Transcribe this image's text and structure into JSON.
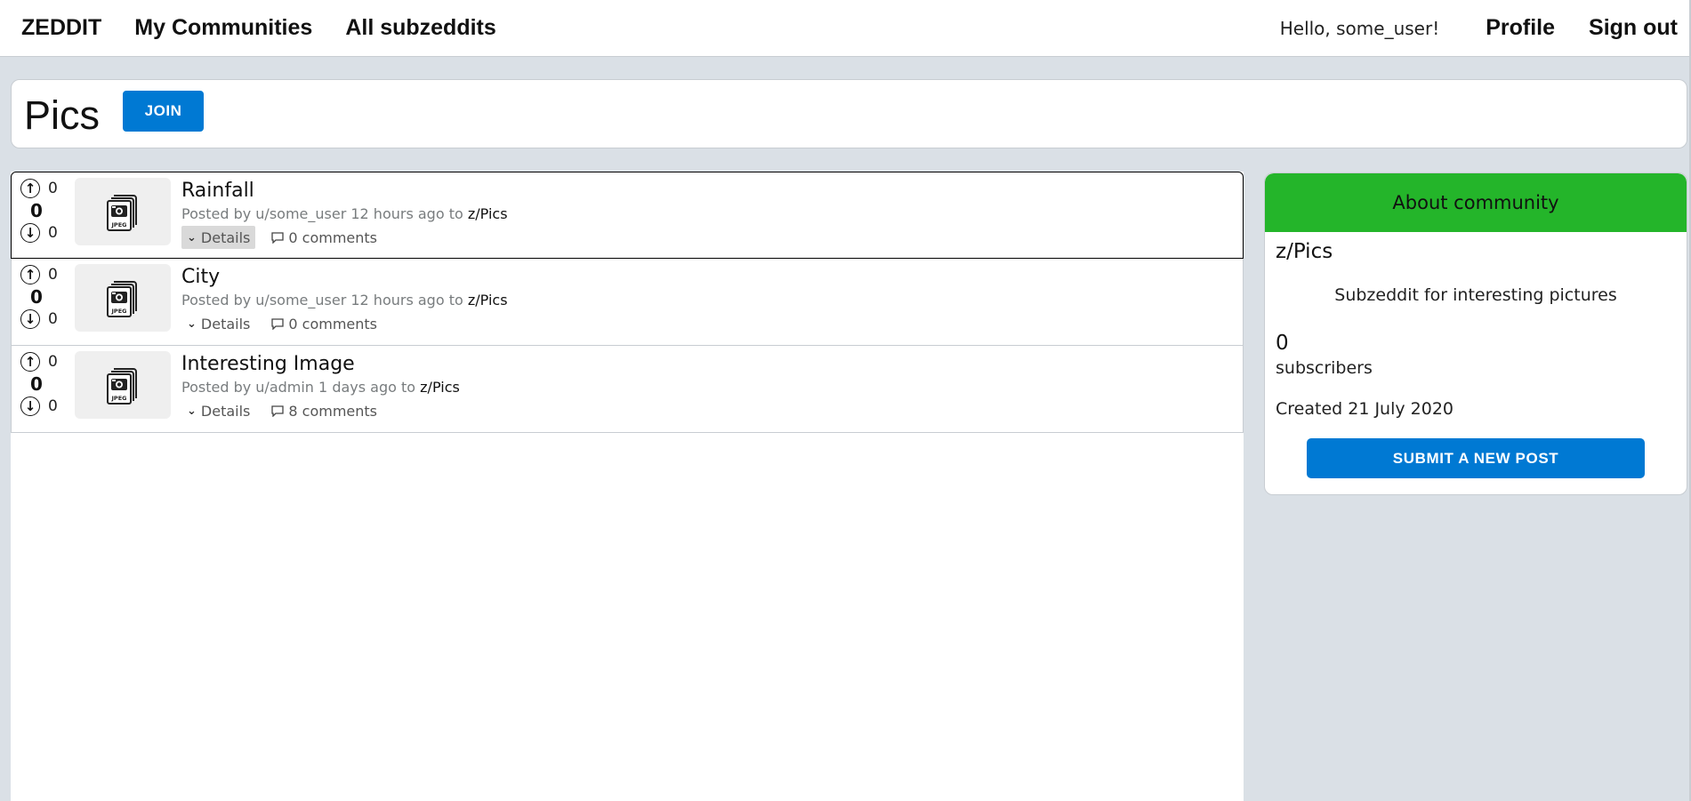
{
  "nav": {
    "brand": "ZEDDIT",
    "my_communities": "My Communities",
    "all_subzeddits": "All subzeddits",
    "greeting": "Hello, some_user!",
    "profile": "Profile",
    "sign_out": "Sign out"
  },
  "community": {
    "title": "Pics",
    "join_label": "JOIN"
  },
  "posts": [
    {
      "upvotes": "0",
      "score": "0",
      "downvotes": "0",
      "thumb_icon": "jpeg-file-icon",
      "title": "Rainfall",
      "posted_by_prefix": "Posted by",
      "user": "u/some_user",
      "time": "12 hours ago to",
      "subzeddit": "z/Pics",
      "details_label": "Details",
      "comments": "0 comments"
    },
    {
      "upvotes": "0",
      "score": "0",
      "downvotes": "0",
      "thumb_icon": "jpeg-file-icon",
      "title": "City",
      "posted_by_prefix": "Posted by",
      "user": "u/some_user",
      "time": "12 hours ago to",
      "subzeddit": "z/Pics",
      "details_label": "Details",
      "comments": "0 comments"
    },
    {
      "upvotes": "0",
      "score": "0",
      "downvotes": "0",
      "thumb_icon": "jpeg-file-icon",
      "title": "Interesting Image",
      "posted_by_prefix": "Posted by",
      "user": "u/admin",
      "time": "1 days ago to",
      "subzeddit": "z/Pics",
      "details_label": "Details",
      "comments": "8 comments"
    }
  ],
  "sidebar": {
    "header": "About community",
    "name": "z/Pics",
    "description": "Subzeddit for interesting pictures",
    "subscriber_count": "0",
    "subscribers_label": "subscribers",
    "created": "Created 21 July 2020",
    "submit_label": "SUBMIT A NEW POST"
  },
  "colors": {
    "accent_blue": "#0079d3",
    "about_green": "#24b52a",
    "page_bg": "#dae0e6"
  }
}
